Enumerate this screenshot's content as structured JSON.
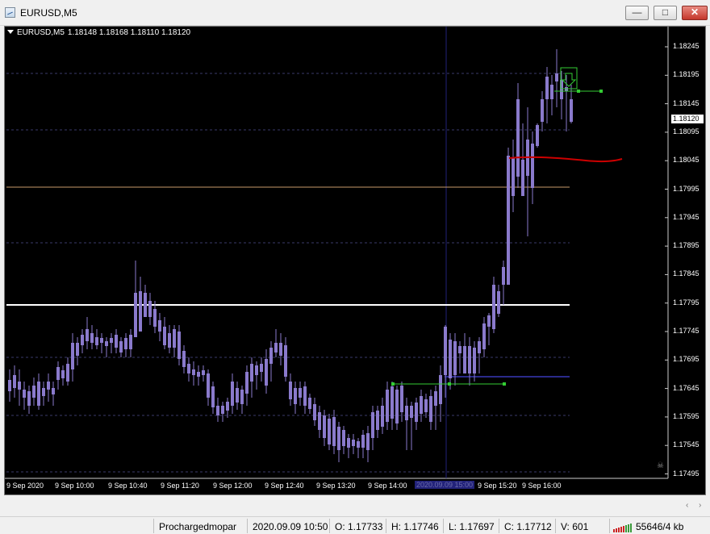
{
  "window": {
    "title": "EURUSD,M5",
    "minimize_label": "—",
    "maximize_label": "□",
    "close_label": "✕"
  },
  "chart": {
    "symbol": "EURUSD,M5",
    "ohlc": "1.18148 1.18168 1.18110 1.18120",
    "current_price": "1.18120",
    "price_labels": [
      "1.18245",
      "1.18195",
      "1.18145",
      "1.18095",
      "1.18045",
      "1.17995",
      "1.17945",
      "1.17895",
      "1.17845",
      "1.17795",
      "1.17745",
      "1.17695",
      "1.17645",
      "1.17595",
      "1.17545",
      "1.17495"
    ],
    "time_labels": [
      "9 Sep 2020",
      "9 Sep 10:00",
      "9 Sep 10:40",
      "9 Sep 11:20",
      "9 Sep 12:00",
      "9 Sep 12:40",
      "9 Sep 13:20",
      "9 Sep 14:00",
      "9 Sep 15:20",
      "9 Sep 16:00"
    ],
    "crosshair_time": "2020.09.09 15:00",
    "colors": {
      "background": "#000000",
      "candle": "#8a7acc",
      "grid": "#3a3a6a",
      "hline_white": "#ffffff",
      "hline_tan": "#c89a6a",
      "hline_navy": "#2a2a8a",
      "red_line": "#cc0000",
      "marker": "#33cc33"
    },
    "icons": {
      "sell_signal": "down-arrow-icon",
      "stop": "skull-icon"
    }
  },
  "statusbar": {
    "profile": "Prochargedmopar",
    "datetime": "2020.09.09 10:50",
    "open": "O: 1.17733",
    "high": "H: 1.17746",
    "low": "L: 1.17697",
    "close": "C: 1.17712",
    "volume": "V: 601",
    "traffic": "55646/4 kb"
  }
}
